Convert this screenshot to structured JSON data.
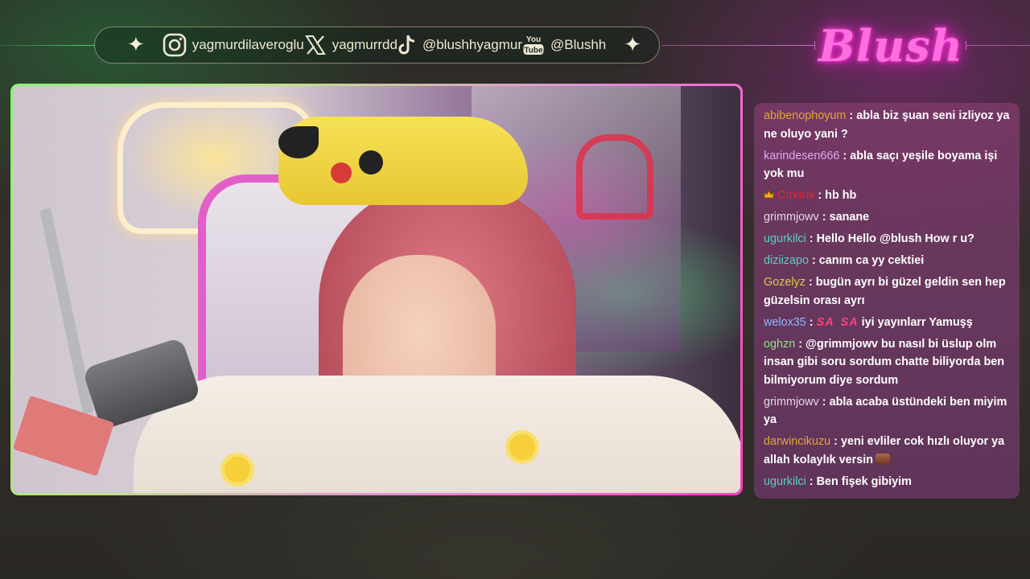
{
  "social": {
    "items": [
      {
        "icon": "instagram-icon",
        "handle": "yagmurdilaveroglu"
      },
      {
        "icon": "x-icon",
        "handle": "yagmurrdd"
      },
      {
        "icon": "tiktok-icon",
        "handle": "@blushhyagmur"
      },
      {
        "icon": "youtube-icon",
        "handle": "@Blushh",
        "icon_text_top": "You",
        "icon_text_bottom": "Tube"
      }
    ]
  },
  "logo": {
    "text": "Blush",
    "color": "#ff5fd9"
  },
  "chat": {
    "messages": [
      {
        "user": "abibenophoyum",
        "color": "#e0a73a",
        "text": "abla biz şuan seni izliyoz ya ne oluyo yani ?"
      },
      {
        "user": "karindesen666",
        "color": "#d7a9f0",
        "text": "abla saçı yeşile boyama işi yok mu"
      },
      {
        "user": "Cırkırık",
        "color": "#e8222e",
        "badge": "crown-icon",
        "text": "hb hb"
      },
      {
        "user": "grimmjowv",
        "color": "#e4d6e4",
        "text": "sanane"
      },
      {
        "user": "ugurkilci",
        "color": "#57d0c6",
        "text": "Hello Hello @blush How r u?"
      },
      {
        "user": "diziizapo",
        "color": "#57d0c6",
        "text": "canım ca yy cektiei"
      },
      {
        "user": "Gozelyz",
        "color": "#e5c34a",
        "text": "bugün ayrı bi güzel geldin sen hep güzelsin orası ayrı"
      },
      {
        "user": "welox35",
        "color": "#8fb7ff",
        "emotes": [
          "SA",
          "SA"
        ],
        "text": "iyi yayınlarr Yamuşş"
      },
      {
        "user": "oghzn",
        "color": "#8fe08a",
        "text": "@grimmjowv bu nasıl bi üslup olm insan gibi soru sordum chatte biliyorda ben bilmiyorum diye sordum"
      },
      {
        "user": "grimmjowv",
        "color": "#e4d6e4",
        "text": "abla acaba üstündeki ben miyim ya"
      },
      {
        "user": "darwincikuzu",
        "color": "#e0a73a",
        "text": "yeni evliler cok hızlı oluyor ya allah kolaylık versin",
        "trailing_emote": "emote-icon"
      },
      {
        "user": "ugurkilci",
        "color": "#57d0c6",
        "text": "Ben fişek gibiyim"
      }
    ]
  }
}
